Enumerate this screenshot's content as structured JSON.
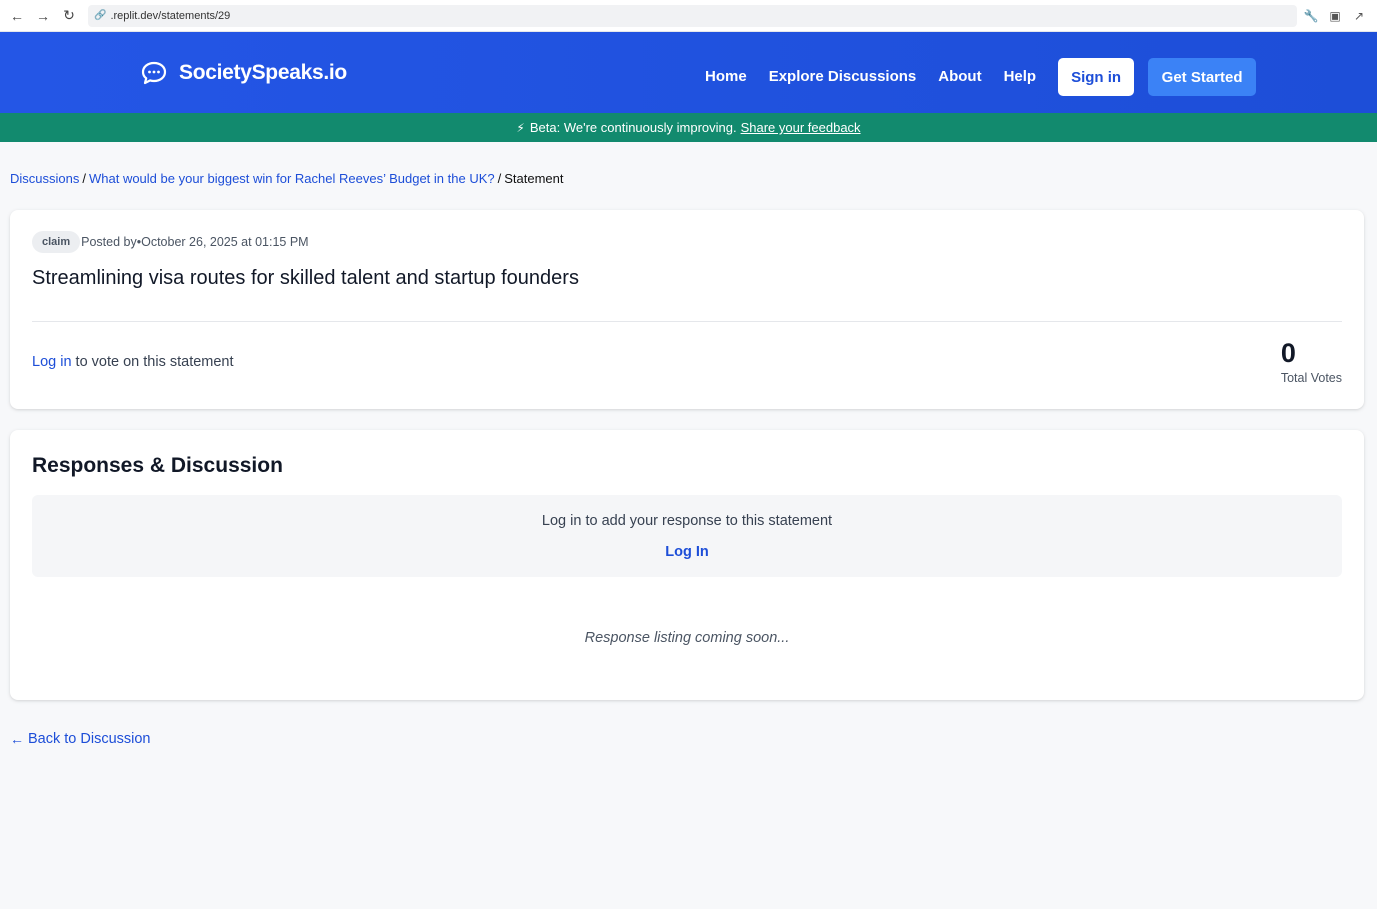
{
  "browser": {
    "url": ".replit.dev/statements/29"
  },
  "header": {
    "brand": "SocietySpeaks.io",
    "nav": [
      "Home",
      "Explore Discussions",
      "About",
      "Help"
    ],
    "signin_label": "Sign in",
    "get_started_label": "Get Started",
    "brand_color": "#1d4ed8"
  },
  "beta": {
    "text": "Beta: We're continuously improving.",
    "link": "Share your feedback",
    "color": "#128a6e"
  },
  "breadcrumb": {
    "discussions": "Discussions",
    "discussion_title": "What would be your biggest win for Rachel Reeves’ Budget in the UK?",
    "current": "Statement"
  },
  "statement": {
    "type_badge": "claim",
    "meta": "Posted by•October 26, 2025 at 01:15 PM",
    "text": "Streamlining visa routes for skilled talent and startup founders",
    "login_link": "Log in",
    "vote_prompt_rest": " to vote on this statement",
    "total_votes": "0",
    "total_votes_label": "Total Votes"
  },
  "responses": {
    "title": "Responses & Discussion",
    "login_prompt": "Log in to add your response to this statement",
    "login_link": "Log In",
    "coming_soon": "Response listing coming soon..."
  },
  "footer": {
    "back_label": "Back to Discussion"
  }
}
